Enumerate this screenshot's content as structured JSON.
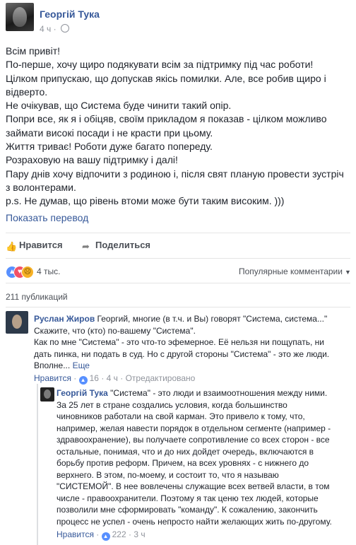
{
  "post": {
    "author": "Георгій Тука",
    "time": "4 ч",
    "lines": [
      "Всім привіт!",
      "По-перше, хочу щиро подякувати всім за підтримку під час роботи!",
      "Цілком припускаю, що допускав якісь помилки. Але, все робив щиро і",
      "відверто.",
      "Не очікував, що Система буде чинити такий опір.",
      "Попри все, як я і обіцяв, своїм прикладом я показав - цілком можливо",
      "займати високі посади і не красти при цьому.",
      "Життя триває! Роботи дуже багато попереду.",
      "Розраховую на вашу підтримку і далі!",
      "Пару днів хочу відпочити з родиною і, після свят планую провести зустріч",
      "з волонтерами.",
      "p.s. Не думав, що рівень втоми може бути таким високим. )))"
    ],
    "translate": "Показать перевод"
  },
  "actions": {
    "like": "Нравится",
    "share": "Поделиться"
  },
  "reactions": {
    "count": "4 тыс.",
    "sort": "Популярные комментарии"
  },
  "shares": "211 публикаций",
  "comments": [
    {
      "author": "Руслан Жиров",
      "lines": [
        "Георгий, многие (в т.ч. и Вы) говорят \"Система, система...\"",
        "Скажите, что (кто) по-вашему \"Система\".",
        "Как по мне \"Система\" - это что-то эфемерное. Её нельзя ни пощупать, ни",
        "дать пинка, ни подать в суд. Но с другой стороны \"Система\" - это же люди.",
        "Вполне..."
      ],
      "more": "Еще",
      "like": "Нравится",
      "likes": "16",
      "time": "4 ч",
      "edited": "Отредактировано"
    },
    {
      "author": "Георгій Тука",
      "lines": [
        "\"Система\" - это люди и взаимоотношения между ними.",
        "За 25 лет в стране создались условия, когда большинство",
        "чиновников работали на свой карман. Это привело к тому, что,",
        "например, желая навести порядок в отдельном сегменте (например -",
        "здравоохранение), вы получаете сопротивление со всех сторон - все",
        "остальные, понимая, что и до них дойдет очередь, включаются в",
        "борьбу против реформ. Причем, на всех уровнях - с нижнего до",
        "верхнего. В этом, по-моему, и состоит то, что я называю",
        "\"СИСТЕМОЙ\". В нее вовлечены служащие всех ветвей власти, в том",
        "числе - правоохранители. Поэтому я так ценю тех людей, которые",
        "позволили мне сформировать \"команду\". К сожалению, закончить",
        "процесс не успел - очень непросто найти желающих жить по-другому."
      ],
      "like": "Нравится",
      "likes": "222",
      "time": "3 ч"
    }
  ]
}
